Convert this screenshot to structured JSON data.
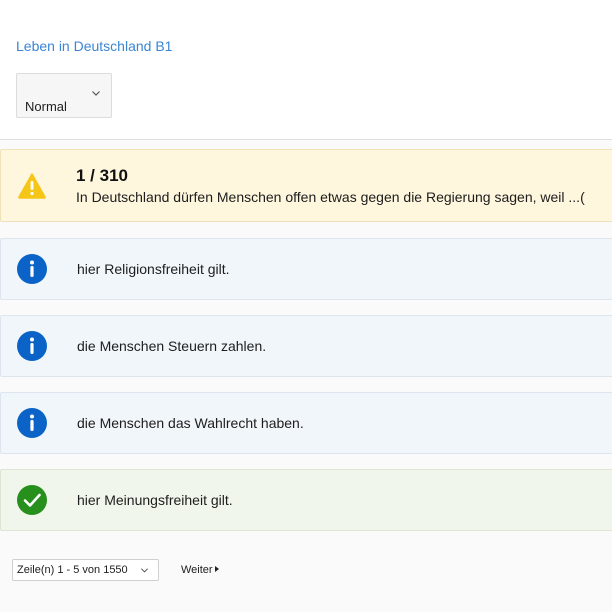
{
  "header": {
    "title": "Leben in Deutschland B1",
    "mode_select": {
      "value": "Normal",
      "icon": "chevron-down-icon"
    }
  },
  "question": {
    "counter": "1 / 310",
    "text": "In Deutschland dürfen Menschen offen etwas gegen die Regierung sagen, weil ...(",
    "icon": "warning-icon",
    "color": "#f5c518"
  },
  "answers": [
    {
      "text": "hier Religionsfreiheit gilt.",
      "state": "info",
      "icon": "info-icon",
      "color": "#0b63c7"
    },
    {
      "text": "die Menschen Steuern zahlen.",
      "state": "info",
      "icon": "info-icon",
      "color": "#0b63c7"
    },
    {
      "text": "die Menschen das Wahlrecht haben.",
      "state": "info",
      "icon": "info-icon",
      "color": "#0b63c7"
    },
    {
      "text": "hier Meinungsfreiheit gilt.",
      "state": "correct",
      "icon": "check-circle-icon",
      "color": "#278f1b"
    }
  ],
  "pagination": {
    "rows_select": "Zeile(n) 1 - 5 von 1550",
    "next_label": "Weiter"
  }
}
